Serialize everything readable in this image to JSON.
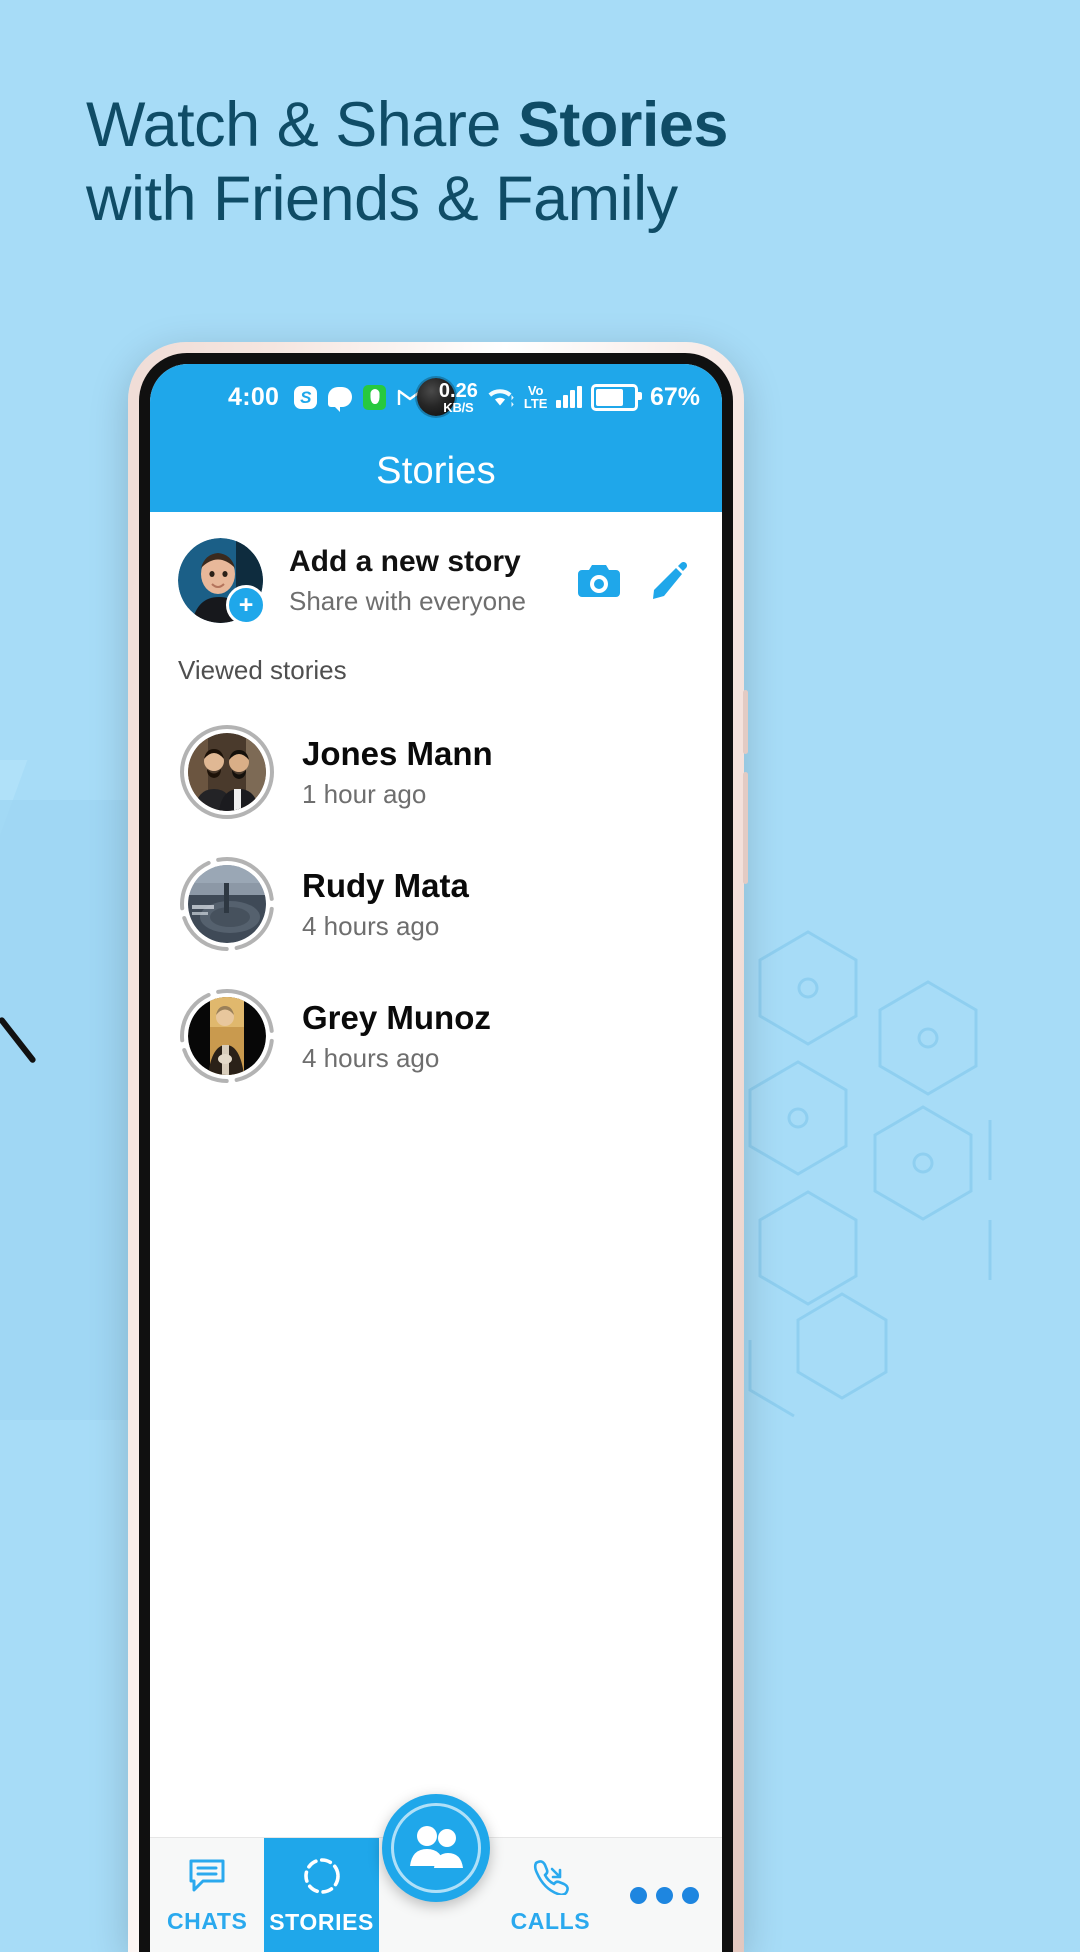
{
  "promo": {
    "headline_line1_plain": "Watch & Share ",
    "headline_line1_bold": "Stories",
    "headline_line2": "with Friends & Family",
    "text_color": "#0f4c66",
    "background_color": "#a7dcf7"
  },
  "statusbar": {
    "time": "4:00",
    "icons": [
      "skype-icon",
      "chat-bubble-icon",
      "shield-icon",
      "gmail-icon"
    ],
    "data_rate_value": "0.26",
    "data_rate_unit": "KB/S",
    "wifi": "wifi-icon",
    "network_line1": "Vo",
    "network_line2": "LTE",
    "signal": "signal-bars-icon",
    "battery_percent": "67%",
    "battery_level": 67
  },
  "appbar": {
    "title": "Stories",
    "background_color": "#1fa7ea"
  },
  "add_story": {
    "title": "Add a new story",
    "subtitle": "Share with everyone",
    "plus_badge": "+",
    "camera_label": "camera-icon",
    "edit_label": "pencil-icon",
    "accent_color": "#1fa7ea"
  },
  "section": {
    "viewed_title": "Viewed stories"
  },
  "stories": [
    {
      "name": "Jones Mann",
      "time": "1 hour ago",
      "seen": true,
      "ring_style": "solid"
    },
    {
      "name": "Rudy Mata",
      "time": "4 hours ago",
      "seen": true,
      "ring_style": "dashed"
    },
    {
      "name": "Grey Munoz",
      "time": "4 hours ago",
      "seen": true,
      "ring_style": "dashed"
    }
  ],
  "bottom_nav": {
    "items": [
      {
        "label": "CHATS",
        "icon": "chat-box-icon",
        "active": false
      },
      {
        "label": "STORIES",
        "icon": "story-circle-icon",
        "active": true
      },
      {
        "label": "CALLS",
        "icon": "phone-call-icon",
        "active": false
      }
    ],
    "fab_icon": "people-icon",
    "more_icon": "more-dots-icon",
    "active_color": "#1fa7ea",
    "inactive_color": "#2aa9ee"
  }
}
